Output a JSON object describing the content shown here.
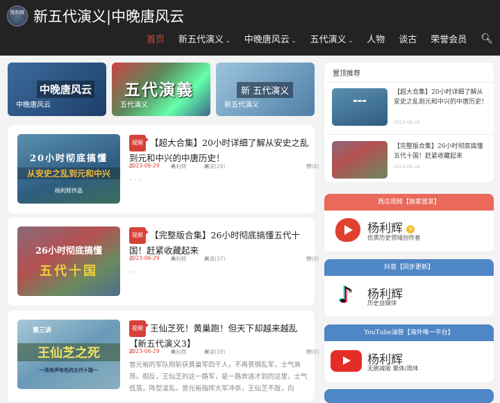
{
  "header": {
    "logo_badge": "杨利辉",
    "site_title": "新五代演义|中晚唐风云",
    "nav": [
      {
        "label": "首页",
        "active": true
      },
      {
        "label": "新五代演义",
        "dropdown": true
      },
      {
        "label": "中晚唐风云",
        "dropdown": true
      },
      {
        "label": "五代演义",
        "dropdown": true
      },
      {
        "label": "人物"
      },
      {
        "label": "谈古"
      },
      {
        "label": "荣誉会员"
      }
    ],
    "search_icon": "search-icon"
  },
  "banners": [
    {
      "label": "中晚唐风云",
      "art": "中晚唐风云"
    },
    {
      "label": "五代演义",
      "art": "五代演義"
    },
    {
      "label": "新五代演义",
      "art": "新 五代演义"
    }
  ],
  "posts": [
    {
      "badge": "视频",
      "title": "【超大合集】20小时详细了解从安史之乱到元和中兴的中唐历史！",
      "date": "2023-06-29",
      "author": "杨利辉",
      "views": "阅读(24)",
      "likes": "赞(0)",
      "thumb": {
        "line1": "20小时彻底搞懂",
        "line2": "从安史之乱到元和中兴",
        "line3": "杨利辉作品"
      }
    },
    {
      "badge": "视频",
      "title": "【完整版合集】26小时彻底搞懂五代十国！赶紧收藏起来",
      "date": "2023-06-29",
      "author": "杨利辉",
      "views": "阅读(37)",
      "likes": "赞(0)",
      "thumb": {
        "line1": "26小时彻底搞懂",
        "line2": "五代十国"
      }
    },
    {
      "badge": "视频",
      "title": "王仙芝死！黄巢跑！但天下却越来越乱【新五代演义3】",
      "date": "2023-06-29",
      "author": "杨利辉",
      "views": "阅读(18)",
      "likes": "赞(0)",
      "excerpt": "曾元裕的军队刚斩获黄巢军四千人，不再畏惧乱军，士气高昂。相反，王仙芝的这一路军，是一路奔逃才到的这里，士气低落，阵型凌乱。曾元裕指挥大军冲杀，王仙芝不敌，向",
      "thumb": {
        "line0": "第三讲",
        "line1": "王仙芝之死",
        "line2": "一迭有声有色的五代十国一"
      }
    }
  ],
  "sidebar": {
    "pinned_title": "置顶推荐",
    "pinned": [
      {
        "title": "【超大合集】20小时详细了解从安史之乱到元和中兴的中唐历史！",
        "date": "2023-06-29"
      },
      {
        "title": "【完整版合集】26小时彻底搞懂五代十国！赶紧收藏起来",
        "date": "2023-06-29"
      }
    ],
    "platforms": [
      {
        "header": "西瓜视频【独家首发】",
        "name": "杨利辉",
        "verified": "V",
        "sub": "优质历史领域创作者",
        "color": "#e9695a"
      },
      {
        "header": "抖音【同步更新】",
        "name": "杨利辉",
        "sub": "历史自媒体",
        "color": "#4f86c6"
      },
      {
        "header": "YouTube油管【海外唯一平台】",
        "name": "杨利辉",
        "sub": "无删减版  繁体/简体",
        "color": "#4f86c6"
      }
    ]
  }
}
